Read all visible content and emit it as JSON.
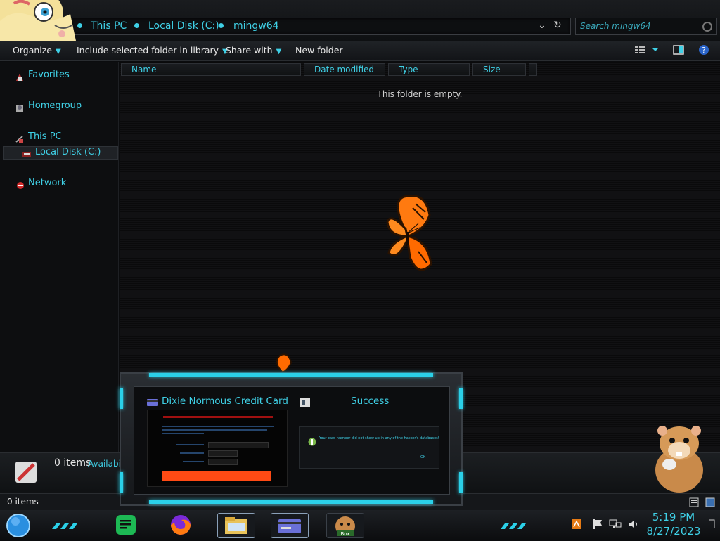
{
  "explorer": {
    "breadcrumb": [
      "This PC",
      "Local Disk (C:)",
      "mingw64"
    ],
    "search_placeholder": "Search mingw64",
    "toolbar": {
      "organize": "Organize",
      "include_library": "Include selected folder in library",
      "share_with": "Share with",
      "new_folder": "New folder"
    },
    "nav": {
      "favorites": "Favorites",
      "homegroup": "Homegroup",
      "this_pc": "This PC",
      "local_disk": "Local Disk (C:)",
      "network": "Network"
    },
    "columns": [
      "Name",
      "Date modified",
      "Type",
      "Size"
    ],
    "empty_message": "This folder is empty.",
    "details_count": "0 items",
    "details_avail": "Availabili",
    "status_text": "0 items"
  },
  "dialog": {
    "title_left": "Dixie Normous Credit Card ...",
    "title_right": "Success",
    "success_message": "Your card number did not show up in any of the hacker's databases!",
    "ok_label": "OK"
  },
  "taskbar": {
    "time": "5:19 PM",
    "date": "8/27/2023"
  },
  "colors": {
    "accent": "#3fd0e6",
    "background": "#0b0c0e",
    "button_orange": "#ff4a14",
    "butterfly": "#ff7a10"
  }
}
